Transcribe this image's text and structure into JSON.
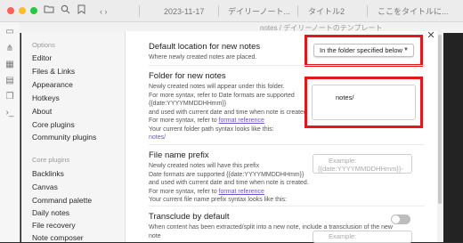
{
  "colors": {
    "close": "#ff5f57",
    "minimize": "#febc2e",
    "zoom": "#28c840",
    "highlight": "#e3161b",
    "link": "#6f52c9"
  },
  "icons": [
    "folder-icon",
    "search-icon",
    "bookmark-icon",
    "chevron-left-icon",
    "chevron-right-icon"
  ],
  "tabs": [
    {
      "label": "2023-11-17"
    },
    {
      "label": "デイリーノート..."
    },
    {
      "label": "タイトル2"
    },
    {
      "label": "ここをタイトルに..."
    }
  ],
  "breadcrumb": "notes / デイリーノートのテンプレート",
  "sidebar": {
    "options_title": "Options",
    "options": [
      "Editor",
      "Files & Links",
      "Appearance",
      "Hotkeys",
      "About",
      "Core plugins",
      "Community plugins"
    ],
    "core_title": "Core plugins",
    "core": [
      "Backlinks",
      "Canvas",
      "Command palette",
      "Daily notes",
      "File recovery",
      "Note composer"
    ]
  },
  "settings": {
    "default_location": {
      "name": "Default location for new notes",
      "desc": "Where newly created notes are placed.",
      "value": "In the folder specified below"
    },
    "folder": {
      "name": "Folder for new notes",
      "desc": [
        "Newly created notes will appear under this folder.",
        "For more syntax, refer to Date formats are supported",
        "{{date:YYYYMMDDHHmm}}",
        "and used with current date and time when note is created."
      ],
      "ref_prefix": "For more syntax, refer to ",
      "ref_link": "format reference",
      "path_label": "Your current folder path syntax looks like this:",
      "path_value": "notes/",
      "value": "notes/"
    },
    "prefix": {
      "name": "File name prefix",
      "desc": [
        "Newly created notes will have this prefix",
        "Date formats are supported {{date:YYYYMMDDHHmm}}",
        "and used with current date and time when note is created."
      ],
      "ref_prefix": "For more syntax, refer to ",
      "ref_link": "format reference",
      "syntax_label": "Your current file name prefix syntax looks like this:",
      "placeholder_1": "Example:",
      "placeholder_2": "{{date:YYYYMMDDHHmm}}-"
    },
    "transclude": {
      "name": "Transclude by default",
      "desc_1": "When content has been extracted/split into a new note, include a transclusion of the new",
      "desc_2": "note",
      "enabled": false
    },
    "next_placeholder": "Example:"
  }
}
